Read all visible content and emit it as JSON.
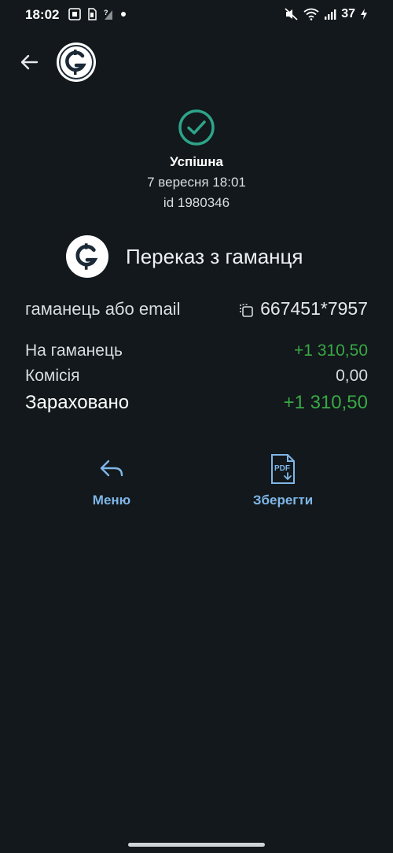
{
  "status_bar": {
    "time": "18:02",
    "battery": "37"
  },
  "header": {
    "back_icon": "arrow-left-icon",
    "logo_icon": "brand-g-logo"
  },
  "transaction": {
    "status": "Успішна",
    "date": "7 вересня 18:01",
    "id": "id 1980346",
    "status_color": "#2ea48a"
  },
  "service": {
    "title": "Переказ з гаманця"
  },
  "wallet": {
    "label": "гаманець або email",
    "value": "667451*7957"
  },
  "amounts": [
    {
      "label": "На гаманець",
      "value": "+1 310,50"
    },
    {
      "label": "Комісія",
      "value": "0,00"
    },
    {
      "label": "Зараховано",
      "value": "+1 310,50"
    }
  ],
  "actions": {
    "menu_label": "Меню",
    "save_label": "Зберегти",
    "pdf_text": "PDF"
  },
  "colors": {
    "background": "#12181b",
    "positive": "#3aa845",
    "accent": "#7fb6e8"
  }
}
